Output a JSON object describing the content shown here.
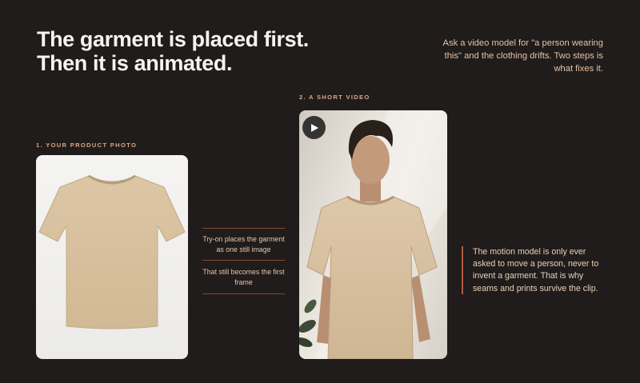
{
  "headline": {
    "line1": "The garment is placed first.",
    "line2": "Then it is animated."
  },
  "intro": "Ask a video model for \"a person wearing this\" and the clothing drifts. Two steps is what fixes it.",
  "steps": {
    "product_photo_label": "1. YOUR PRODUCT PHOTO",
    "video_label": "2. A SHORT VIDEO"
  },
  "connector": {
    "text1": "Try-on places the garment as one still image",
    "text2": "That still becomes the first frame"
  },
  "note": "The motion model is only ever asked to move a person, never to invent a garment. That is why seams and prints survive the clip.",
  "icons": {
    "play": "play-icon"
  },
  "colors": {
    "background": "#1f1c1b",
    "accent": "#b35a44",
    "label": "#d9a889",
    "garment": "#d9c3a1"
  }
}
